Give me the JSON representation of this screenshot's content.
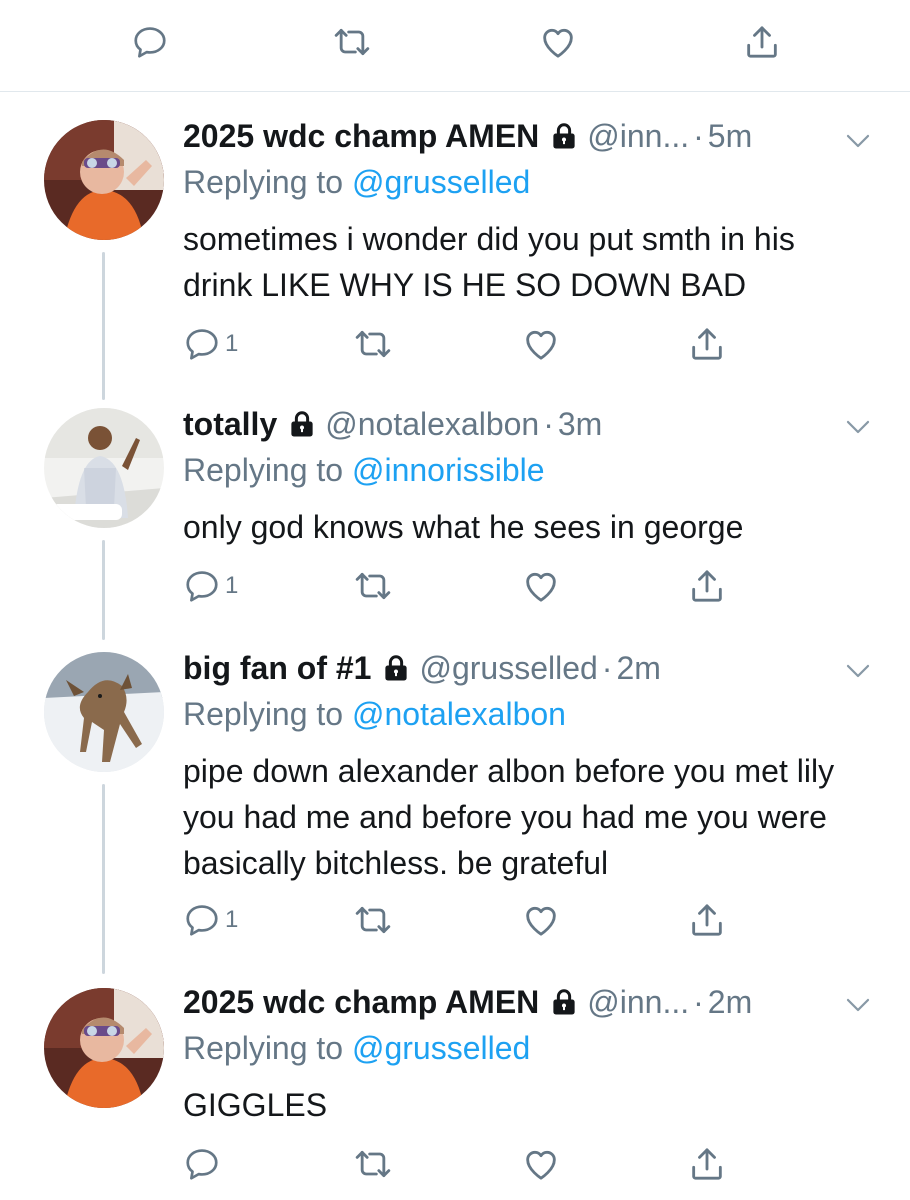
{
  "colors": {
    "text": "#14171a",
    "secondary": "#657786",
    "link": "#1da1f2",
    "icon": "#657786",
    "thread_line": "#cdd6dd"
  },
  "top_actions": [
    "reply-icon",
    "retweet-icon",
    "like-icon",
    "share-icon"
  ],
  "tweets": [
    {
      "name": "2025 wdc champ AMEN",
      "handle": "@inn...",
      "time": "5m",
      "replying_label": "Replying to",
      "replying_to": "@grusselled",
      "text": "sometimes i wonder did you put smth in his drink LIKE WHY IS HE SO DOWN BAD",
      "reply_count": "1"
    },
    {
      "name": "totally",
      "handle": "@notalexalbon",
      "time": "3m",
      "replying_label": "Replying to",
      "replying_to": "@innorissible",
      "text": "only god knows what he sees in george",
      "reply_count": "1"
    },
    {
      "name": "big fan of #1",
      "handle": "@grusselled",
      "time": "2m",
      "replying_label": "Replying to",
      "replying_to": "@notalexalbon",
      "text": "pipe down alexander albon before you met lily you had me and before you had me you were basically bitchless. be grateful",
      "reply_count": "1"
    },
    {
      "name": "2025 wdc champ AMEN",
      "handle": "@inn...",
      "time": "2m",
      "replying_label": "Replying to",
      "replying_to": "@grusselled",
      "text": "GIGGLES",
      "reply_count": ""
    }
  ]
}
